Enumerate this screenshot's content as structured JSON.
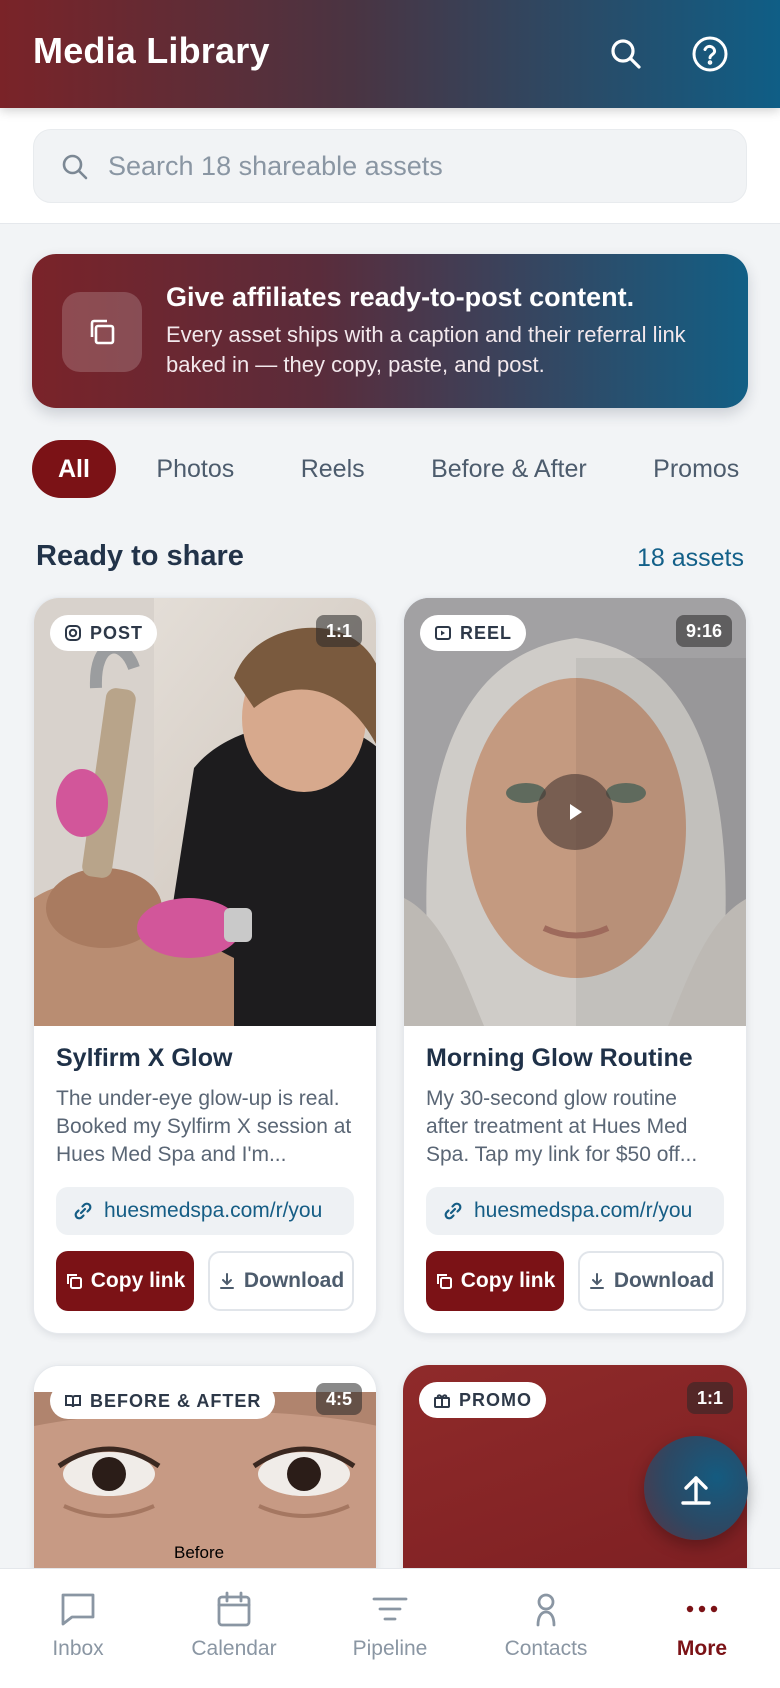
{
  "app": {
    "title": "Media Library"
  },
  "header": {
    "search_icon": "search-icon",
    "help_icon": "help-circle-icon"
  },
  "search": {
    "placeholder": "Search 18 shareable assets",
    "value": ""
  },
  "banner": {
    "title": "Give affiliates ready-to-post content.",
    "body": "Every asset ships with a caption and their referral link baked in — they copy, paste, and post.",
    "icon": "copy-icon"
  },
  "filters": [
    "All",
    "Photos",
    "Reels",
    "Before & After",
    "Promos"
  ],
  "filters_active": "All",
  "section": {
    "title": "Ready to share",
    "count": "18 assets"
  },
  "assets": [
    {
      "type": "POST",
      "ratio": "1:1",
      "title": "Sylfirm X Glow",
      "caption": "The under-eye glow-up is real. Booked my Sylfirm X session at Hues Med Spa and I'm...",
      "link": "huesmedspa.com/r/you",
      "copy_label": "Copy link",
      "download_label": "Download"
    },
    {
      "type": "REEL",
      "ratio": "9:16",
      "title": "Morning Glow Routine",
      "caption": "My 30-second glow routine after treatment at Hues Med Spa. Tap my link for $50 off...",
      "link": "huesmedspa.com/r/you",
      "copy_label": "Copy link",
      "download_label": "Download"
    },
    {
      "type": "BEFORE & AFTER",
      "ratio": "4:5",
      "image_label": "Before"
    },
    {
      "type": "PROMO",
      "ratio": "1:1"
    }
  ],
  "nav": [
    {
      "label": "Inbox",
      "icon": "chat-icon"
    },
    {
      "label": "Calendar",
      "icon": "calendar-icon"
    },
    {
      "label": "Pipeline",
      "icon": "filter-lines-icon"
    },
    {
      "label": "Contacts",
      "icon": "person-icon"
    },
    {
      "label": "More",
      "icon": "more-dots-icon",
      "active": true
    }
  ],
  "colors": {
    "accent": "#7b1216",
    "link": "#136089"
  }
}
